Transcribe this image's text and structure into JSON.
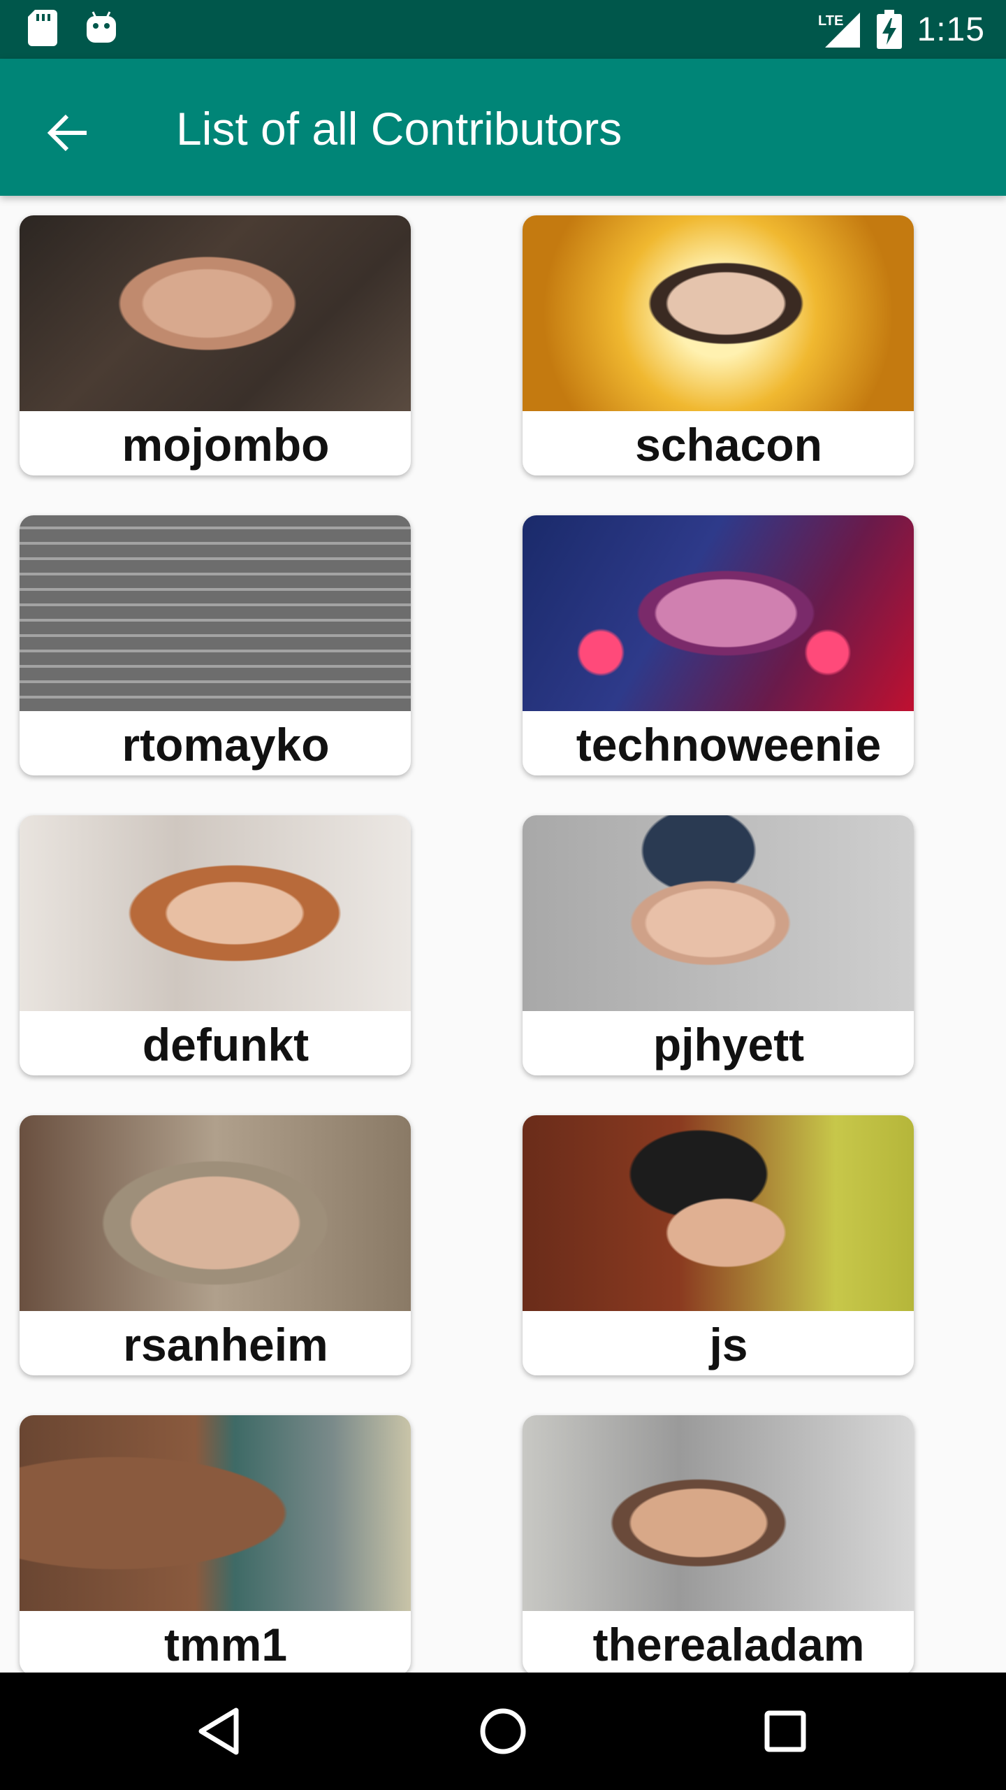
{
  "status_bar": {
    "icons": [
      "sd-card-icon",
      "android-icon",
      "lte-signal-icon",
      "battery-charging-icon"
    ],
    "network": "LTE",
    "time": "1:15"
  },
  "app_bar": {
    "back_icon": "arrow-back-icon",
    "title": "List of all Contributors"
  },
  "contributors": [
    {
      "login": "mojombo"
    },
    {
      "login": "schacon"
    },
    {
      "login": "rtomayko"
    },
    {
      "login": "technoweenie"
    },
    {
      "login": "defunkt"
    },
    {
      "login": "pjhyett"
    },
    {
      "login": "rsanheim"
    },
    {
      "login": "js"
    },
    {
      "login": "tmm1"
    },
    {
      "login": "therealadam"
    }
  ],
  "nav_bar": {
    "icons": [
      "nav-back-icon",
      "nav-home-icon",
      "nav-recents-icon"
    ]
  },
  "colors": {
    "status_bar": "#00574b",
    "app_bar": "#008577",
    "background": "#fafafa",
    "card": "#ffffff",
    "nav_bar": "#000000"
  }
}
